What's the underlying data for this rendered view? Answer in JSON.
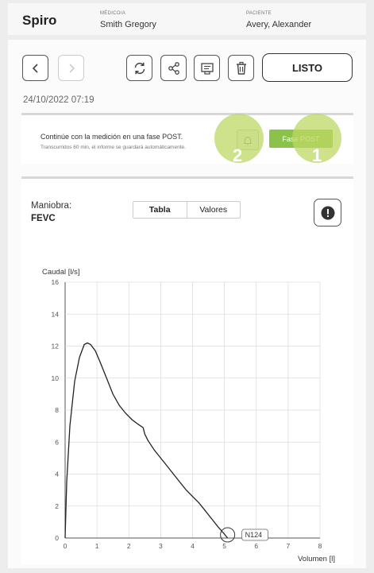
{
  "header": {
    "app_title": "Spiro",
    "doctor_caption": "MÉDICO/A",
    "doctor_name": "Smith Gregory",
    "patient_caption": "PACIENTE",
    "patient_name": "Avery, Alexander"
  },
  "toolbar": {
    "done_label": "LISTO",
    "datetime": "24/10/2022 07:19"
  },
  "banner": {
    "message": "Continúe con la medición en una fase POST.",
    "sub_message": "Transcurridos 60 min, el informe se guardará automáticamente.",
    "post_button_label": "Fase POST",
    "marker_1": "1",
    "marker_2": "2"
  },
  "maneuver": {
    "label": "Maniobra:",
    "value": "FEVC",
    "tabs": [
      "Tabla",
      "Valores"
    ],
    "active_tab": "Tabla"
  },
  "chart_data": {
    "type": "line",
    "ylabel": "Caudal [l/s]",
    "xlabel": "Volumen [l]",
    "xlim": [
      0,
      8
    ],
    "ylim": [
      0,
      16
    ],
    "xticks": [
      0,
      1,
      2,
      3,
      4,
      5,
      6,
      7,
      8
    ],
    "yticks": [
      0,
      2,
      4,
      6,
      8,
      10,
      12,
      14,
      16
    ],
    "grid": true,
    "series": [
      {
        "x": [
          0,
          0.05,
          0.15,
          0.3,
          0.45,
          0.6,
          0.7,
          0.8,
          0.95,
          1.1,
          1.3,
          1.5,
          1.7,
          1.9,
          2.1,
          2.3,
          2.45,
          2.5,
          2.6,
          2.8,
          3.0,
          3.2,
          3.4,
          3.6,
          3.8,
          4.0,
          4.2,
          4.4,
          4.6,
          4.8,
          5.0,
          5.1
        ],
        "y": [
          0,
          3.5,
          7.0,
          9.8,
          11.3,
          12.1,
          12.2,
          12.1,
          11.7,
          11.0,
          10.0,
          9.0,
          8.3,
          7.8,
          7.4,
          7.1,
          6.9,
          6.5,
          6.1,
          5.5,
          5.0,
          4.5,
          4.0,
          3.5,
          3.0,
          2.6,
          2.2,
          1.7,
          1.2,
          0.7,
          0.25,
          0
        ]
      }
    ],
    "annotation": "N124"
  }
}
